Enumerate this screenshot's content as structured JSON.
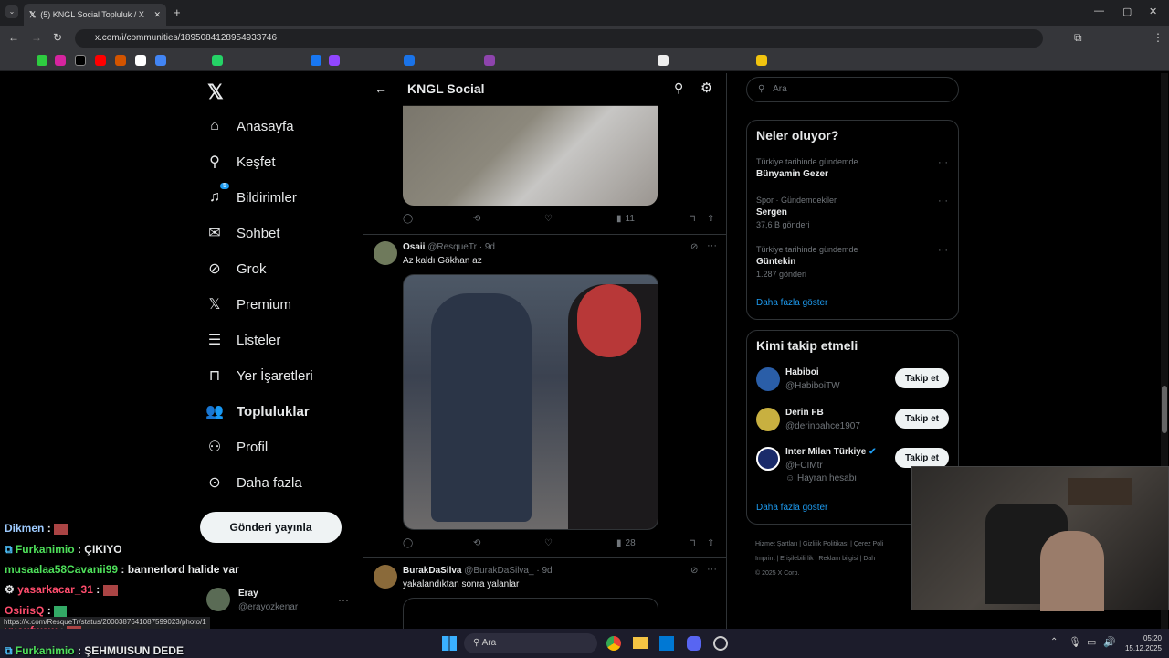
{
  "browser": {
    "tab_title": "(5) KNGL Social Topluluk / X",
    "url": "x.com/i/communities/1895084128954933746",
    "status_url": "https://x.com/ResqueTr/status/2000387641087599023/photo/1"
  },
  "nav": {
    "items": [
      "Anasayfa",
      "Keşfet",
      "Bildirimler",
      "Sohbet",
      "Grok",
      "Premium",
      "Listeler",
      "Yer İşaretleri",
      "Topluluklar",
      "Profil",
      "Daha fazla"
    ],
    "notif_badge": "5",
    "post_button": "Gönderi yayınla",
    "account": {
      "name": "Eray",
      "handle": "@erayozkenar"
    }
  },
  "header": {
    "title": "KNGL Social"
  },
  "posts": [
    {
      "stats": {
        "views": "11"
      }
    },
    {
      "name": "Osaii",
      "handle": "@ResqueTr",
      "time": "9d",
      "text": "Az kaldı Gökhan az",
      "stats": {
        "views": "28"
      }
    },
    {
      "name": "BurakDaSilva",
      "handle": "@BurakDaSilva_",
      "time": "9d",
      "text": "yakalandıktan sonra yalanlar"
    }
  ],
  "search": {
    "placeholder": "Ara"
  },
  "trends": {
    "title": "Neler oluyor?",
    "items": [
      {
        "context": "Türkiye tarihinde gündemde",
        "name": "Bünyamin Gezer",
        "count": ""
      },
      {
        "context": "Spor · Gündemdekiler",
        "name": "Sergen",
        "count": "37,6 B gönderi"
      },
      {
        "context": "Türkiye tarihinde gündemde",
        "name": "Güntekin",
        "count": "1.287 gönderi"
      }
    ],
    "more": "Daha fazla göster"
  },
  "who_to_follow": {
    "title": "Kimi takip etmeli",
    "items": [
      {
        "name": "Habiboi",
        "handle": "@HabiboiTW",
        "extra": ""
      },
      {
        "name": "Derin FB",
        "handle": "@derinbahce1907",
        "extra": ""
      },
      {
        "name": "Inter Milan Türkiye",
        "handle": "@FCIMtr",
        "extra": "Hayran hesabı"
      }
    ],
    "follow_label": "Takip et",
    "more": "Daha fazla göster"
  },
  "footer": {
    "links": [
      "Hizmet Şartları",
      "Gizlilik Politikası",
      "Çerez Poli",
      "Imprint",
      "Erişilebilirlik",
      "Reklam bilgisi",
      "Dah"
    ],
    "copyright": "© 2025 X Corp."
  },
  "chat": [
    {
      "user": "Dikmen",
      "msg": "",
      "color": "#9ecbff"
    },
    {
      "user": "Furkanimio",
      "msg": "ÇIKIYO",
      "color": "#4ee05a"
    },
    {
      "user": "musaalaa58Cavanii99",
      "msg": "bannerlord halide var",
      "color": "#4ee05a"
    },
    {
      "user": "yasarkacar_31",
      "msg": "",
      "color": "#ff4d6d"
    },
    {
      "user": "OsirisQ",
      "msg": "",
      "color": "#ff4d6d"
    },
    {
      "user": "yusufwsw",
      "msg": "",
      "color": "#ff4d6d"
    },
    {
      "user": "Furkanimio",
      "msg": "ŞEHMUISUN DEDE",
      "color": "#4ee05a"
    }
  ],
  "taskbar": {
    "search": "Ara",
    "time": "05:20",
    "date": "15.12.2025"
  }
}
